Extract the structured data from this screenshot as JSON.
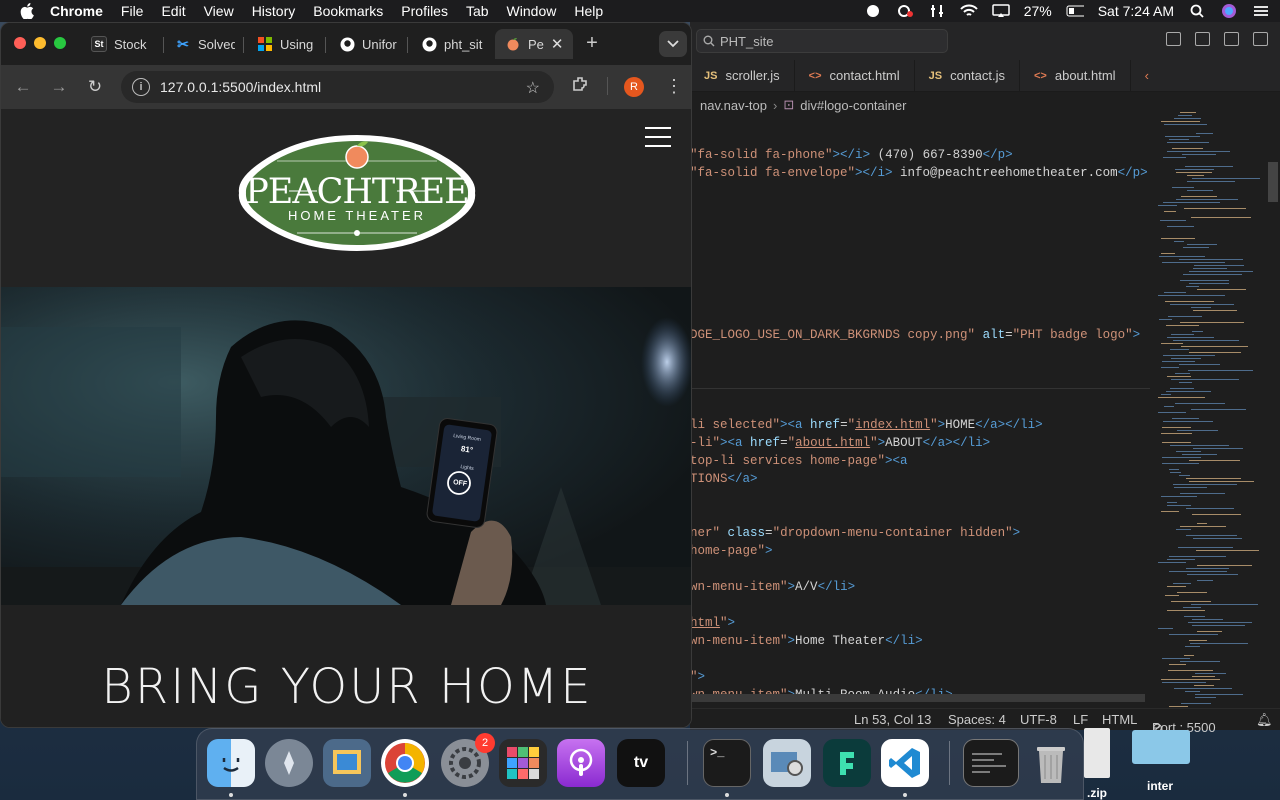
{
  "menubar": {
    "app_name": "Chrome",
    "items": [
      "File",
      "Edit",
      "View",
      "History",
      "Bookmarks",
      "Profiles",
      "Tab",
      "Window",
      "Help"
    ],
    "battery": "27%",
    "clock": "Sat 7:24 AM"
  },
  "browser": {
    "tabs": [
      {
        "label": "Stock",
        "icon": "st-favicon"
      },
      {
        "label": "Solved",
        "icon": "puzzle-favicon"
      },
      {
        "label": "Using",
        "icon": "microsoft-favicon"
      },
      {
        "label": "Unifor",
        "icon": "github-favicon"
      },
      {
        "label": "pht_sit",
        "icon": "github-favicon"
      },
      {
        "label": "Pe",
        "icon": "peach-favicon",
        "active": true
      }
    ],
    "url": "127.0.0.1:5500/index.html",
    "profile_initial": "R"
  },
  "website": {
    "logo_title": "PEACHTREE",
    "logo_subtitle": "HOME THEATER",
    "hero_phone_text": {
      "heading": "Living Room",
      "temp": "81°",
      "label": "Lights",
      "button": "OFF"
    },
    "headline": "BRING YOUR HOME"
  },
  "editor": {
    "search": "PHT_site",
    "tabs": [
      {
        "type": "JS",
        "label": "scroller.js"
      },
      {
        "type": "<>",
        "label": "contact.html"
      },
      {
        "type": "JS",
        "label": "contact.js"
      },
      {
        "type": "<>",
        "label": "about.html"
      }
    ],
    "breadcrumb": [
      "nav.nav-top",
      "div#logo-container"
    ],
    "code_lines": [
      {
        "frag": "\"fa-solid fa-phone\"></i> (470) 667-8390</p>"
      },
      {
        "frag": "\"fa-solid fa-envelope\"></i> info@peachtreehometheater.com</p>"
      },
      {
        "frag": "DGE_LOGO_USE_ON_DARK_BKGRNDS copy.png\" alt=\"PHT badge logo\">"
      },
      {
        "frag": "li selected\"><a href=\"index.html\">HOME</a></li>"
      },
      {
        "frag": "-li\"><a href=\"about.html\">ABOUT</a></li>"
      },
      {
        "frag": "top-li services home-page\"><a"
      },
      {
        "frag": "TIONS</a>"
      },
      {
        "frag": "ner\" class=\"dropdown-menu-container hidden\">"
      },
      {
        "frag": "home-page\">"
      },
      {
        "frag": "wn-menu-item\">A/V</li>"
      },
      {
        "frag": "html\">"
      },
      {
        "frag": "wn-menu-item\">Home Theater</li>"
      },
      {
        "frag": "\">"
      },
      {
        "frag": "wn-menu-item\">Multi-Room Audio</li>"
      }
    ],
    "status": {
      "position": "Ln 53, Col 13",
      "spaces": "Spaces: 4",
      "encoding": "UTF-8",
      "eol": "LF",
      "language": "HTML",
      "port": "Port : 5500"
    }
  },
  "dock": {
    "apps": [
      "finder",
      "launchpad",
      "preview",
      "chrome",
      "system-settings",
      "sketchbook",
      "podcasts",
      "apple-tv",
      "terminal",
      "image-capture",
      "filmora",
      "vscode",
      "terminal-window",
      "trash"
    ],
    "settings_badge": "2",
    "desktop_items": [
      ".zip",
      "inter"
    ]
  },
  "colors": {
    "logo_green": "#4a7a3c",
    "peach": "#f08a5d",
    "chrome_bg": "#1f1f1f",
    "vscode_bg": "#1e1e1e"
  }
}
